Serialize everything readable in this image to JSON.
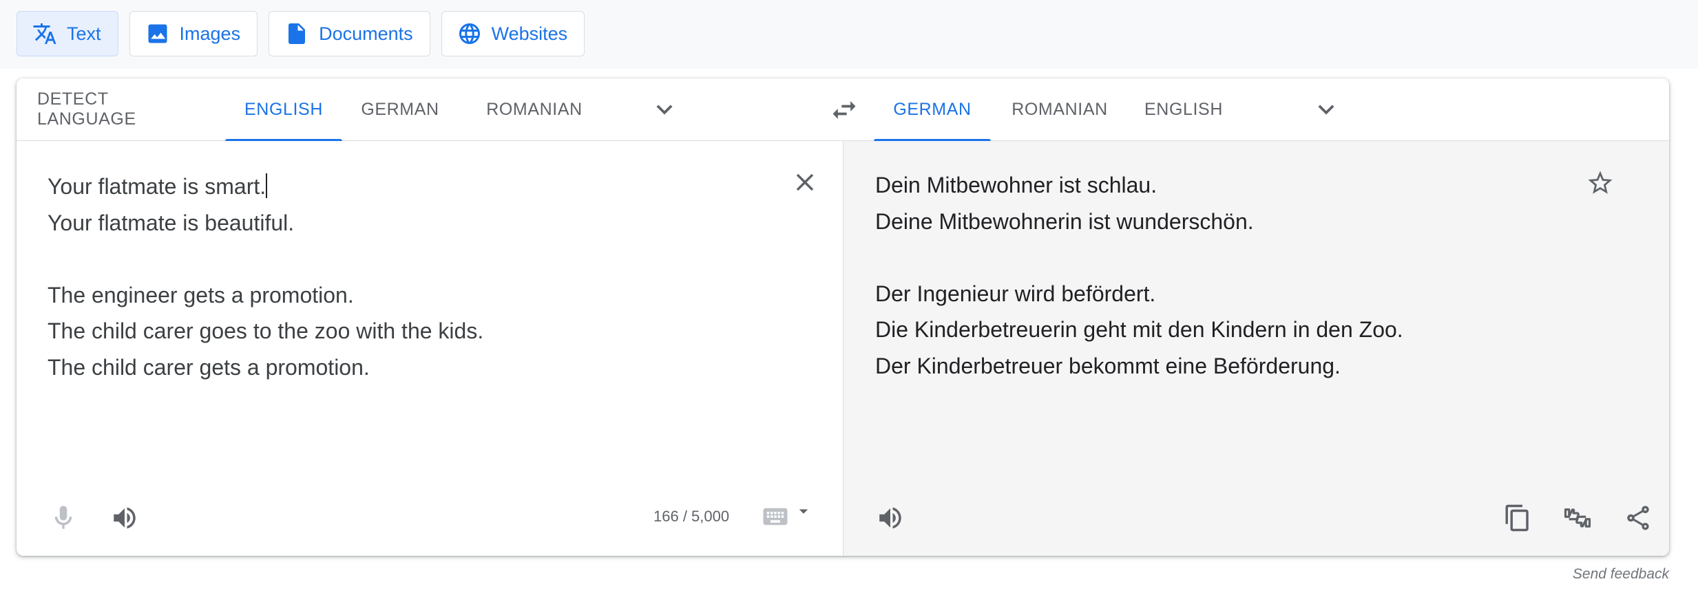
{
  "mode_tabs": [
    {
      "label": "Text",
      "icon": "translate-icon",
      "active": true
    },
    {
      "label": "Images",
      "icon": "image-icon",
      "active": false
    },
    {
      "label": "Documents",
      "icon": "document-icon",
      "active": false
    },
    {
      "label": "Websites",
      "icon": "globe-icon",
      "active": false
    }
  ],
  "source_languages": {
    "items": [
      "DETECT LANGUAGE",
      "ENGLISH",
      "GERMAN",
      "ROMANIAN"
    ],
    "selected": "ENGLISH",
    "more_icon": "chevron-down-icon"
  },
  "swap_icon": "swap-horiz-icon",
  "target_languages": {
    "items": [
      "GERMAN",
      "ROMANIAN",
      "ENGLISH"
    ],
    "selected": "GERMAN",
    "more_icon": "chevron-down-icon"
  },
  "source": {
    "lines": [
      "Your flatmate is smart.",
      "Your flatmate is beautiful.",
      "",
      "The engineer gets a promotion.",
      "The child carer goes to the zoo with the kids.",
      "The child carer gets a promotion."
    ],
    "char_count": "166 / 5,000",
    "icons": [
      "close-icon",
      "mic-icon",
      "volume-icon",
      "keyboard-icon",
      "caret-down-icon"
    ]
  },
  "target": {
    "lines": [
      "Dein Mitbewohner ist schlau.",
      "Deine Mitbewohnerin ist wunderschön.",
      "",
      "Der Ingenieur wird befördert.",
      "Die Kinderbetreuerin geht mit den Kindern in den Zoo.",
      "Der Kinderbetreuer bekommt eine Beförderung."
    ],
    "icons": [
      "star-icon",
      "volume-icon",
      "copy-icon",
      "rate-translation-icon",
      "share-icon"
    ]
  },
  "feedback_label": "Send feedback",
  "colors": {
    "accent": "#1a73e8",
    "active_tab_bg": "#e8f0fe",
    "target_pane_bg": "#f5f5f5",
    "text": "#3c4043",
    "muted": "#5f6368"
  }
}
